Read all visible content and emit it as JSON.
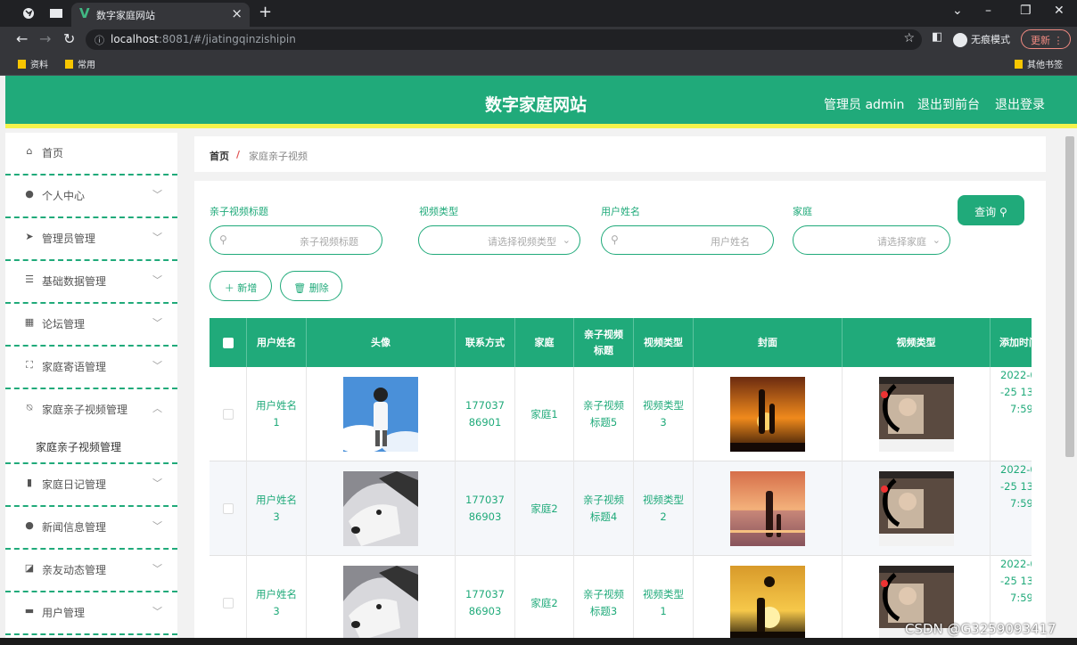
{
  "browser": {
    "tab_title": "数字家庭网站",
    "url_host": "localhost",
    "url_rest": ":8081/#/jiatingqinzishipin",
    "incognito_label": "无痕模式",
    "update_label": "更新",
    "bookmarks": [
      "资料",
      "常用"
    ],
    "other_bookmarks": "其他书签"
  },
  "header": {
    "site_title": "数字家庭网站",
    "admin_label": "管理员 admin",
    "to_front": "退出到前台",
    "logout": "退出登录"
  },
  "sidebar": {
    "items": [
      {
        "label": "首页",
        "icon": "home-icon"
      },
      {
        "label": "个人中心",
        "icon": "user-icon"
      },
      {
        "label": "管理员管理",
        "icon": "send-icon"
      },
      {
        "label": "基础数据管理",
        "icon": "list-icon"
      },
      {
        "label": "论坛管理",
        "icon": "grid-icon"
      },
      {
        "label": "家庭寄语管理",
        "icon": "frame-icon"
      },
      {
        "label": "家庭亲子视频管理",
        "icon": "bell-off-icon"
      },
      {
        "label": "家庭日记管理",
        "icon": "chart-icon"
      },
      {
        "label": "新闻信息管理",
        "icon": "person-icon"
      },
      {
        "label": "亲友动态管理",
        "icon": "trend-icon"
      },
      {
        "label": "用户管理",
        "icon": "monitor-icon"
      }
    ],
    "submenu": "家庭亲子视频管理"
  },
  "breadcrumb": {
    "home": "首页",
    "sep": "/",
    "current": "家庭亲子视频"
  },
  "filters": {
    "title_label": "亲子视频标题",
    "title_ph": "亲子视频标题",
    "type_label": "视频类型",
    "type_ph": "请选择视频类型",
    "user_label": "用户姓名",
    "user_ph": "用户姓名",
    "family_label": "家庭",
    "family_ph": "请选择家庭",
    "query": "查询"
  },
  "actions": {
    "add": "新增",
    "delete": "删除"
  },
  "table": {
    "headers": [
      "用户姓名",
      "头像",
      "联系方式",
      "家庭",
      "亲子视频标题",
      "视频类型",
      "封面",
      "视频类型",
      "添加时间"
    ],
    "rows": [
      {
        "user": "用户姓名1",
        "phone": "17703786901",
        "family": "家庭1",
        "title": "亲子视频标题5",
        "type": "视频类型3",
        "date": "2022-0",
        "time1": "-25 13",
        "time2": "7:59"
      },
      {
        "user": "用户姓名3",
        "phone": "17703786903",
        "family": "家庭2",
        "title": "亲子视频标题4",
        "type": "视频类型2",
        "date": "2022-0",
        "time1": "-25 13",
        "time2": "7:59"
      },
      {
        "user": "用户姓名3",
        "phone": "17703786903",
        "family": "家庭2",
        "title": "亲子视频标题3",
        "type": "视频类型1",
        "date": "2022-0",
        "time1": "-25 13",
        "time2": "7:59"
      }
    ]
  },
  "watermark": "CSDN @G3259093417"
}
